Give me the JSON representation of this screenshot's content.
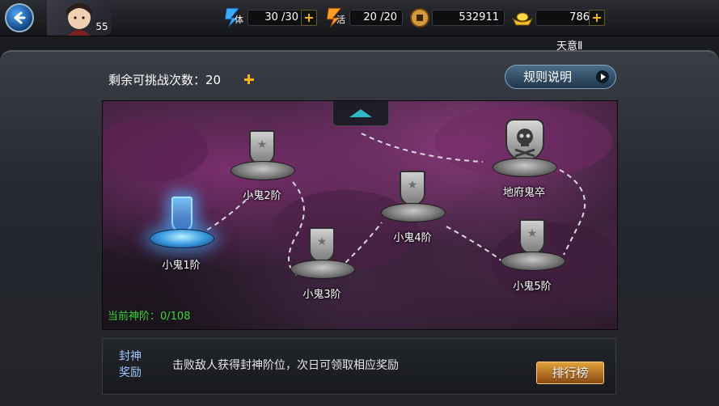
{
  "top_bar": {
    "avatar_level": "55",
    "player_name": "天意Ⅱ",
    "stamina": {
      "icon_text": "体",
      "value": "30 /30"
    },
    "energy": {
      "icon_text": "活",
      "value": "20 /20"
    },
    "coins": {
      "value": "532911"
    },
    "ingots": {
      "value": "786"
    }
  },
  "header": {
    "challenges_label": "剩余可挑战次数：20",
    "rules_button": "规则说明"
  },
  "map": {
    "nodes": [
      {
        "label": "小鬼1阶",
        "state": "current"
      },
      {
        "label": "小鬼2阶",
        "state": "locked"
      },
      {
        "label": "小鬼3阶",
        "state": "locked"
      },
      {
        "label": "小鬼4阶",
        "state": "locked"
      },
      {
        "label": "小鬼5阶",
        "state": "locked"
      },
      {
        "label": "地府鬼卒",
        "state": "boss"
      }
    ],
    "progress": "当前神阶：0/108"
  },
  "reward": {
    "title": "封神奖励",
    "description": "击败敌人获得封神阶位，次日可领取相应奖励",
    "rank_button": "排行榜"
  },
  "colors": {
    "accent_gold": "#f5b21a",
    "progress_green": "#3ddc3d",
    "portal_blue": "#4aa8ff"
  }
}
